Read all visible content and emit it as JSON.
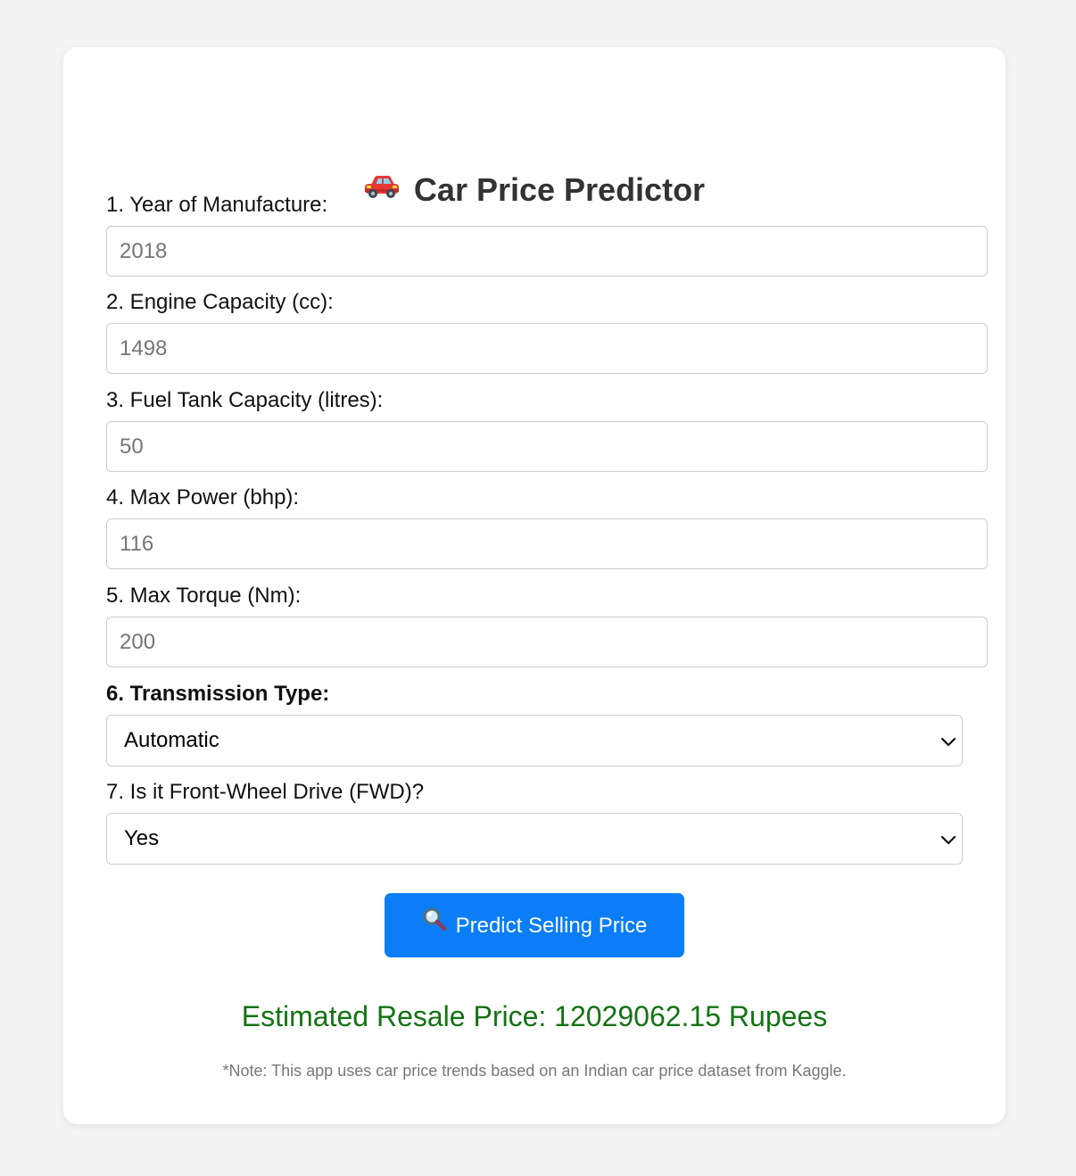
{
  "header": {
    "title": "Car Price Predictor",
    "icon": "car-icon"
  },
  "fields": [
    {
      "label": "1. Year of Manufacture:",
      "placeholder": "2018",
      "value": ""
    },
    {
      "label": "2. Engine Capacity (cc):",
      "placeholder": "1498",
      "value": ""
    },
    {
      "label": "3. Fuel Tank Capacity (litres):",
      "placeholder": "50",
      "value": ""
    },
    {
      "label": "4. Max Power (bhp):",
      "placeholder": "116",
      "value": ""
    },
    {
      "label": "5. Max Torque (Nm):",
      "placeholder": "200",
      "value": ""
    }
  ],
  "transmission": {
    "label": "6. Transmission Type:",
    "selected": "Automatic"
  },
  "fwd": {
    "label": "7. Is it Front-Wheel Drive (FWD)?",
    "selected": "Yes"
  },
  "predict_button": {
    "label": "Predict Selling Price",
    "icon": "magnifier-icon"
  },
  "result": {
    "text": "Estimated Resale Price: 12029062.15 Rupees"
  },
  "note": "*Note: This app uses car price trends based on an Indian car price dataset from Kaggle.",
  "colors": {
    "page_background": "#f4f4f4",
    "card_background": "#ffffff",
    "button": "#0a7df7",
    "result_text": "#137313",
    "title_text": "#333333"
  }
}
